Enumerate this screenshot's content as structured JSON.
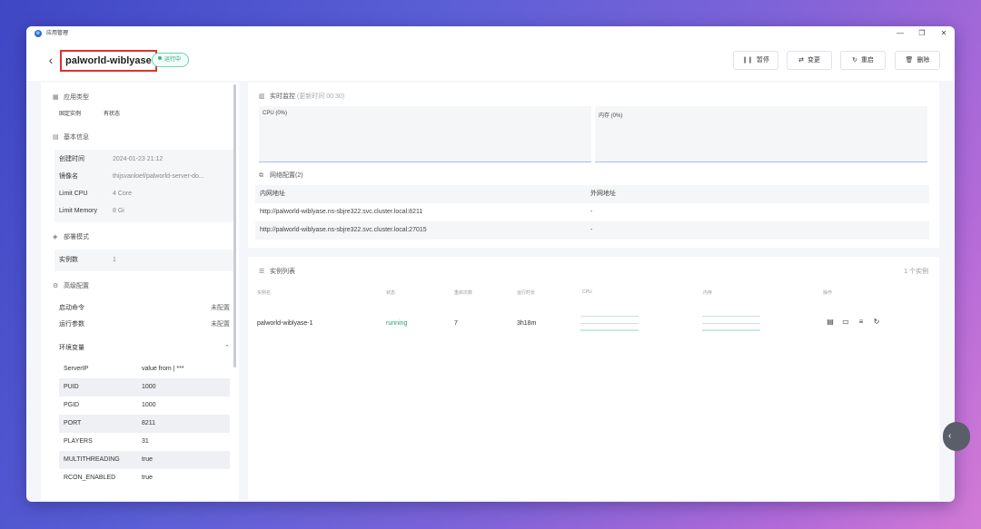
{
  "window": {
    "title": "应用管理",
    "controls": [
      "—",
      "❐",
      "✕"
    ]
  },
  "header": {
    "back_icon": "‹",
    "app_name": "palworld-wiblyase",
    "status": "运行中",
    "buttons": [
      {
        "icon": "❙❙",
        "label": "暂停"
      },
      {
        "icon": "⇄",
        "label": "变更"
      },
      {
        "icon": "↻",
        "label": "重启"
      },
      {
        "icon": "🗑",
        "label": "删除"
      }
    ]
  },
  "left": {
    "app_type": {
      "title": "应用类型",
      "tags": [
        "固定实例",
        "有状态"
      ]
    },
    "basic_info": {
      "title": "基本信息",
      "rows": [
        {
          "k": "创建时间",
          "v": "2024-01-23 21:12"
        },
        {
          "k": "镜像名",
          "v": "thijsvanloef/palworld-server-do..."
        },
        {
          "k": "Limit CPU",
          "v": "4 Core"
        },
        {
          "k": "Limit Memory",
          "v": "8 Gi"
        }
      ]
    },
    "deploy_mode": {
      "title": "部署模式",
      "rows": [
        {
          "k": "实例数",
          "v": "1"
        }
      ]
    },
    "advanced": {
      "title": "高级配置",
      "rows": [
        {
          "k": "启动命令",
          "v": "未配置"
        },
        {
          "k": "运行参数",
          "v": "未配置"
        }
      ],
      "env_title": "环境变量",
      "env_toggle": "⌃",
      "env": [
        {
          "k": "ServerIP",
          "v": "value from | ***"
        },
        {
          "k": "PUID",
          "v": "1000"
        },
        {
          "k": "PGID",
          "v": "1000"
        },
        {
          "k": "PORT",
          "v": "8211"
        },
        {
          "k": "PLAYERS",
          "v": "31"
        },
        {
          "k": "MULTITHREADING",
          "v": "true"
        },
        {
          "k": "RCON_ENABLED",
          "v": "true"
        }
      ]
    }
  },
  "monitor": {
    "title": "实时监控",
    "update_note": "(更新时间 00:30)",
    "cpu_label": "CPU (0%)",
    "mem_label": "内存 (0%)"
  },
  "network": {
    "title": "网络配置(2)",
    "headers": [
      "内网地址",
      "外网地址"
    ],
    "rows": [
      {
        "internal": "http://palworld-wiblyase.ns-sbjre322.svc.cluster.local:8211",
        "external": "-"
      },
      {
        "internal": "http://palworld-wiblyase.ns-sbjre322.svc.cluster.local:27015",
        "external": "-"
      }
    ]
  },
  "instances": {
    "title": "实例列表",
    "count": "1 个实例",
    "headers": [
      "实例名",
      "状态",
      "重启次数",
      "运行时长",
      "CPU",
      "内存",
      "操作"
    ],
    "rows": [
      {
        "name": "palworld-wiblyase-1",
        "status": "running",
        "restarts": "7",
        "uptime": "3h18m"
      }
    ],
    "status_color": "#21a67a"
  },
  "icons": {
    "app": "⚙",
    "grid": "▦",
    "info": "▤",
    "deploy": "◈",
    "advanced": "⚙",
    "monitor": "▥",
    "network": "⧉",
    "list": "☰",
    "op_logs": "▤",
    "op_terminal": "▭",
    "op_detail": "≡",
    "op_restart": "↻",
    "edge": "‹"
  },
  "colors": {
    "accent": "#2f6bd9",
    "highlight_border": "#e0302a",
    "running": "#21a67a"
  }
}
